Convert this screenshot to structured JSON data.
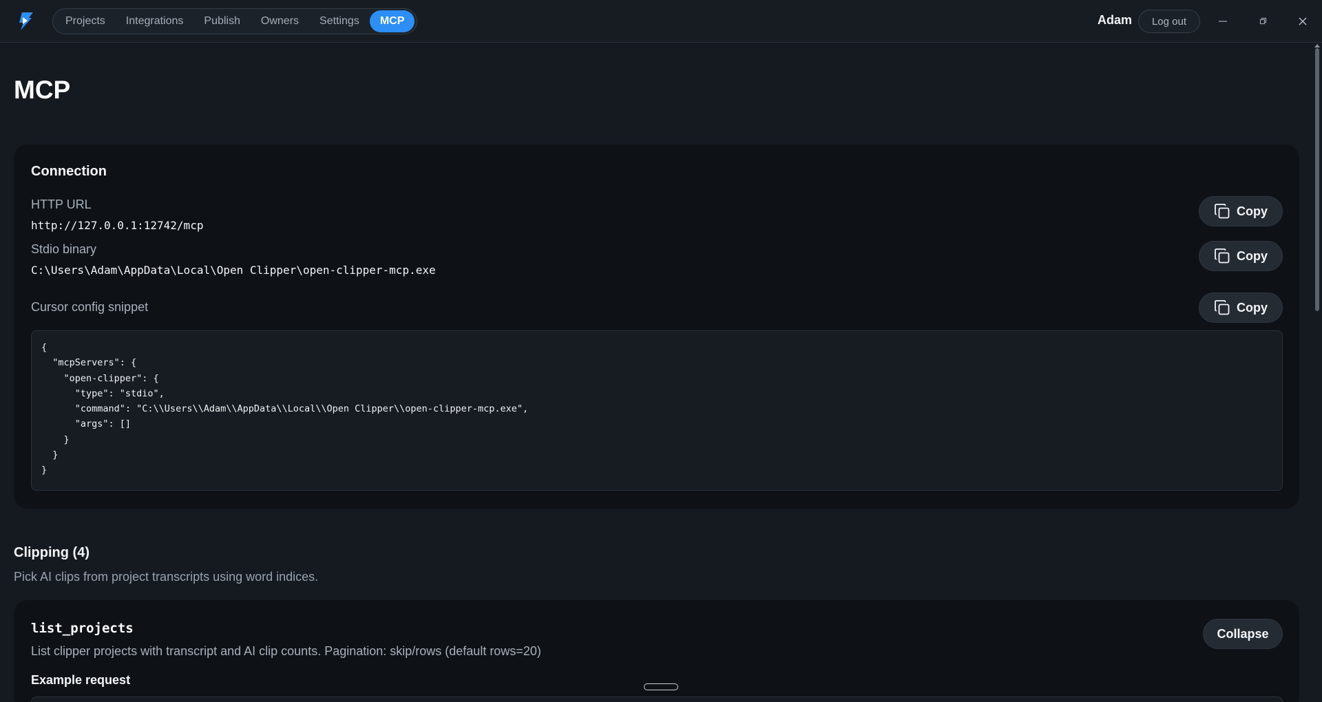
{
  "nav": {
    "items": [
      {
        "label": "Projects",
        "active": false
      },
      {
        "label": "Integrations",
        "active": false
      },
      {
        "label": "Publish",
        "active": false
      },
      {
        "label": "Owners",
        "active": false
      },
      {
        "label": "Settings",
        "active": false
      },
      {
        "label": "MCP",
        "active": true
      }
    ]
  },
  "user": {
    "name": "Adam",
    "logout_label": "Log out"
  },
  "page": {
    "title": "MCP"
  },
  "connection": {
    "title": "Connection",
    "http_url_label": "HTTP URL",
    "http_url_value": "http://127.0.0.1:12742/mcp",
    "stdio_label": "Stdio binary",
    "stdio_value": "C:\\Users\\Adam\\AppData\\Local\\Open Clipper\\open-clipper-mcp.exe",
    "cursor_label": "Cursor config snippet",
    "copy_label": "Copy",
    "snippet": "{\n  \"mcpServers\": {\n    \"open-clipper\": {\n      \"type\": \"stdio\",\n      \"command\": \"C:\\\\Users\\\\Adam\\\\AppData\\\\Local\\\\Open Clipper\\\\open-clipper-mcp.exe\",\n      \"args\": []\n    }\n  }\n}"
  },
  "clipping": {
    "title": "Clipping (4)",
    "subtitle": "Pick AI clips from project transcripts using word indices.",
    "tool": {
      "name": "list_projects",
      "description": "List clipper projects with transcript and AI clip counts. Pagination: skip/rows (default rows=20)",
      "collapse_label": "Collapse",
      "example_label": "Example request"
    }
  },
  "colors": {
    "accent": "#2d8ef5",
    "background": "#151a21",
    "card": "#0e1217"
  }
}
